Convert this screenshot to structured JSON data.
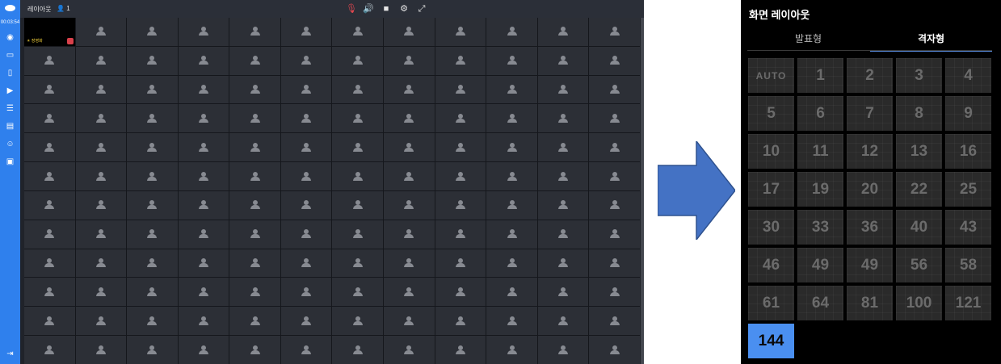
{
  "conference": {
    "title": "레이아웃",
    "participant_count": "1",
    "timer": "00:03:54",
    "self_label": "☀ 장영화",
    "grid_rows": 12,
    "grid_cols": 12,
    "accent_color": "#2f80ed"
  },
  "toolbar_icons": [
    "mic-muted-icon",
    "speaker-icon",
    "camera-icon",
    "gear-icon",
    "fullscreen-icon"
  ],
  "sidebar_icons": [
    "user-circle-icon",
    "screen-share-icon",
    "clipboard-icon",
    "video-icon",
    "chat-icon",
    "document-icon",
    "smile-icon",
    "card-icon",
    "exit-icon"
  ],
  "layout_panel": {
    "title": "화면 레이아웃",
    "tabs": [
      {
        "label": "발표형",
        "active": false
      },
      {
        "label": "격자형",
        "active": true
      }
    ],
    "options": [
      "AUTO",
      "1",
      "2",
      "3",
      "4",
      "5",
      "6",
      "7",
      "8",
      "9",
      "10",
      "11",
      "12",
      "13",
      "16",
      "17",
      "19",
      "20",
      "22",
      "25",
      "30",
      "33",
      "36",
      "40",
      "43",
      "46",
      "49",
      "49",
      "56",
      "58",
      "61",
      "64",
      "81",
      "100",
      "121",
      "144"
    ],
    "selected": "144",
    "selected_color": "#4a8ff0"
  }
}
